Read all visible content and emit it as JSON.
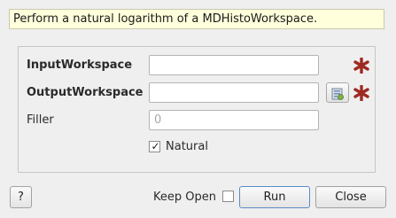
{
  "dialog": {
    "description": "Perform a natural logarithm of a MDHistoWorkspace."
  },
  "properties": {
    "input_workspace": {
      "label": "InputWorkspace",
      "value": "",
      "required": true,
      "required_icon": "red-asterisk-icon"
    },
    "output_workspace": {
      "label": "OutputWorkspace",
      "value": "",
      "required": true,
      "required_icon": "red-asterisk-icon",
      "browse_icon": "workspace-browse-icon"
    },
    "filler": {
      "label": "Filler",
      "placeholder": "0"
    },
    "natural": {
      "label": "Natural",
      "checked": true,
      "check_glyph": "✓"
    }
  },
  "footer": {
    "help_label": "?",
    "keep_open_label": "Keep Open",
    "keep_open_checked": false,
    "run_label": "Run",
    "close_label": "Close"
  },
  "colors": {
    "required_star": "#9e2a22",
    "description_bg": "#ffffdc",
    "default_button_border": "#5a8cc8"
  }
}
